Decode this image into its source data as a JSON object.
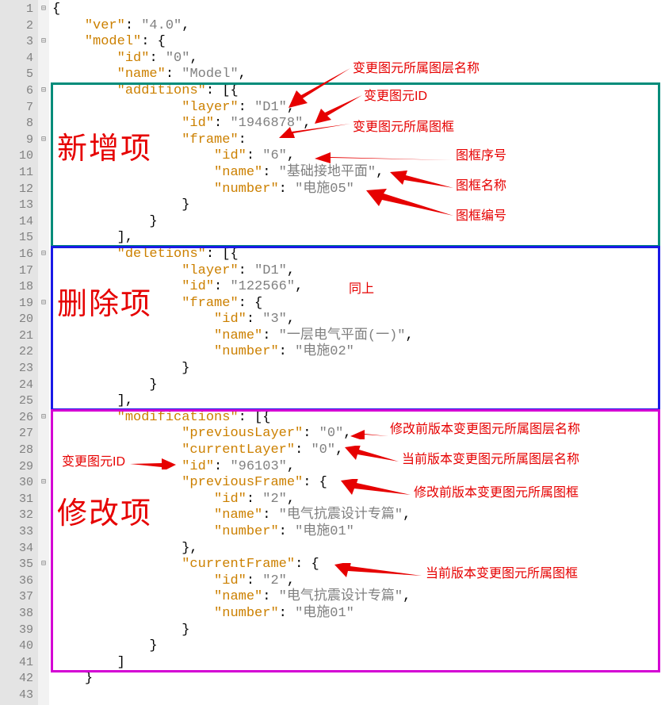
{
  "lines": [
    {
      "n": 1,
      "fold": "⊟",
      "k": null,
      "v": null,
      "post": "{"
    },
    {
      "n": 2,
      "fold": "",
      "k": "ver",
      "v": "4.0",
      "post": ","
    },
    {
      "n": 3,
      "fold": "⊟",
      "k": "model",
      "v": null,
      "post": ": {"
    },
    {
      "n": 4,
      "fold": "",
      "k": "id",
      "v": "0",
      "post": ","
    },
    {
      "n": 5,
      "fold": "",
      "k": "name",
      "v": "Model",
      "post": ","
    },
    {
      "n": 6,
      "fold": "⊟",
      "k": "additions",
      "v": null,
      "post": ": [{"
    },
    {
      "n": 7,
      "fold": "",
      "k": "layer",
      "v": "D1",
      "post": ","
    },
    {
      "n": 8,
      "fold": "",
      "k": "id",
      "v": "1946878",
      "post": ","
    },
    {
      "n": 9,
      "fold": "⊟",
      "k": "frame",
      "v": null,
      "post": ":"
    },
    {
      "n": 10,
      "fold": "",
      "k": "id",
      "v": "6",
      "post": ","
    },
    {
      "n": 11,
      "fold": "",
      "k": "name",
      "v": "基础接地平面",
      "post": ","
    },
    {
      "n": 12,
      "fold": "",
      "k": "number",
      "v": "电施05",
      "post": ""
    },
    {
      "n": 13,
      "fold": "",
      "k": null,
      "v": null,
      "post": "}"
    },
    {
      "n": 14,
      "fold": "",
      "k": null,
      "v": null,
      "post": "}"
    },
    {
      "n": 15,
      "fold": "",
      "k": null,
      "v": null,
      "post": "],"
    },
    {
      "n": 16,
      "fold": "⊟",
      "k": "deletions",
      "v": null,
      "post": ": [{"
    },
    {
      "n": 17,
      "fold": "",
      "k": "layer",
      "v": "D1",
      "post": ","
    },
    {
      "n": 18,
      "fold": "",
      "k": "id",
      "v": "122566",
      "post": ","
    },
    {
      "n": 19,
      "fold": "⊟",
      "k": "frame",
      "v": null,
      "post": ": {"
    },
    {
      "n": 20,
      "fold": "",
      "k": "id",
      "v": "3",
      "post": ","
    },
    {
      "n": 21,
      "fold": "",
      "k": "name",
      "v": "一层电气平面(一)",
      "post": ","
    },
    {
      "n": 22,
      "fold": "",
      "k": "number",
      "v": "电施02",
      "post": ""
    },
    {
      "n": 23,
      "fold": "",
      "k": null,
      "v": null,
      "post": "}"
    },
    {
      "n": 24,
      "fold": "",
      "k": null,
      "v": null,
      "post": "}"
    },
    {
      "n": 25,
      "fold": "",
      "k": null,
      "v": null,
      "post": "],"
    },
    {
      "n": 26,
      "fold": "⊟",
      "k": "modifications",
      "v": null,
      "post": ": [{"
    },
    {
      "n": 27,
      "fold": "",
      "k": "previousLayer",
      "v": "0",
      "post": ","
    },
    {
      "n": 28,
      "fold": "",
      "k": "currentLayer",
      "v": "0",
      "post": ","
    },
    {
      "n": 29,
      "fold": "",
      "k": "id",
      "v": "96103",
      "post": ","
    },
    {
      "n": 30,
      "fold": "⊟",
      "k": "previousFrame",
      "v": null,
      "post": ": {"
    },
    {
      "n": 31,
      "fold": "",
      "k": "id",
      "v": "2",
      "post": ","
    },
    {
      "n": 32,
      "fold": "",
      "k": "name",
      "v": "电气抗震设计专篇",
      "post": ","
    },
    {
      "n": 33,
      "fold": "",
      "k": "number",
      "v": "电施01",
      "post": ""
    },
    {
      "n": 34,
      "fold": "",
      "k": null,
      "v": null,
      "post": "},"
    },
    {
      "n": 35,
      "fold": "⊟",
      "k": "currentFrame",
      "v": null,
      "post": ": {"
    },
    {
      "n": 36,
      "fold": "",
      "k": "id",
      "v": "2",
      "post": ","
    },
    {
      "n": 37,
      "fold": "",
      "k": "name",
      "v": "电气抗震设计专篇",
      "post": ","
    },
    {
      "n": 38,
      "fold": "",
      "k": "number",
      "v": "电施01",
      "post": ""
    },
    {
      "n": 39,
      "fold": "",
      "k": null,
      "v": null,
      "post": "}"
    },
    {
      "n": 40,
      "fold": "",
      "k": null,
      "v": null,
      "post": "}"
    },
    {
      "n": 41,
      "fold": "",
      "k": null,
      "v": null,
      "post": "]"
    },
    {
      "n": 42,
      "fold": "",
      "k": null,
      "v": null,
      "post": "}"
    },
    {
      "n": 43,
      "fold": "",
      "k": null,
      "v": null,
      "post": ""
    }
  ],
  "indent_map": {
    "1": 0,
    "2": 1,
    "3": 1,
    "4": 2,
    "5": 2,
    "6": 2,
    "7": 4,
    "8": 4,
    "9": 4,
    "10": 5,
    "11": 5,
    "12": 5,
    "13": 4,
    "14": 3,
    "15": 2,
    "16": 2,
    "17": 4,
    "18": 4,
    "19": 4,
    "20": 5,
    "21": 5,
    "22": 5,
    "23": 4,
    "24": 3,
    "25": 2,
    "26": 2,
    "27": 4,
    "28": 4,
    "29": 4,
    "30": 4,
    "31": 5,
    "32": 5,
    "33": 5,
    "34": 4,
    "35": 4,
    "36": 5,
    "37": 5,
    "38": 5,
    "39": 4,
    "40": 3,
    "41": 2,
    "42": 1,
    "43": 0
  },
  "boxes": {
    "add": {
      "top_line": 6,
      "bottom_line": 15,
      "label": "新增项"
    },
    "del": {
      "top_line": 16,
      "bottom_line": 25,
      "label": "删除项"
    },
    "mod": {
      "top_line": 26,
      "bottom_line": 41,
      "label": "修改项"
    }
  },
  "annotations": {
    "a1": "变更图元所属图层名称",
    "a2": "变更图元ID",
    "a3": "变更图元所属图框",
    "a4": "图框序号",
    "a5": "图框名称",
    "a6": "图框编号",
    "a7": "同上",
    "a8": "修改前版本变更图元所属图层名称",
    "a9": "当前版本变更图元所属图层名称",
    "a10": "变更图元ID",
    "a11": "修改前版本变更图元所属图框",
    "a12": "当前版本变更图元所属图框"
  }
}
